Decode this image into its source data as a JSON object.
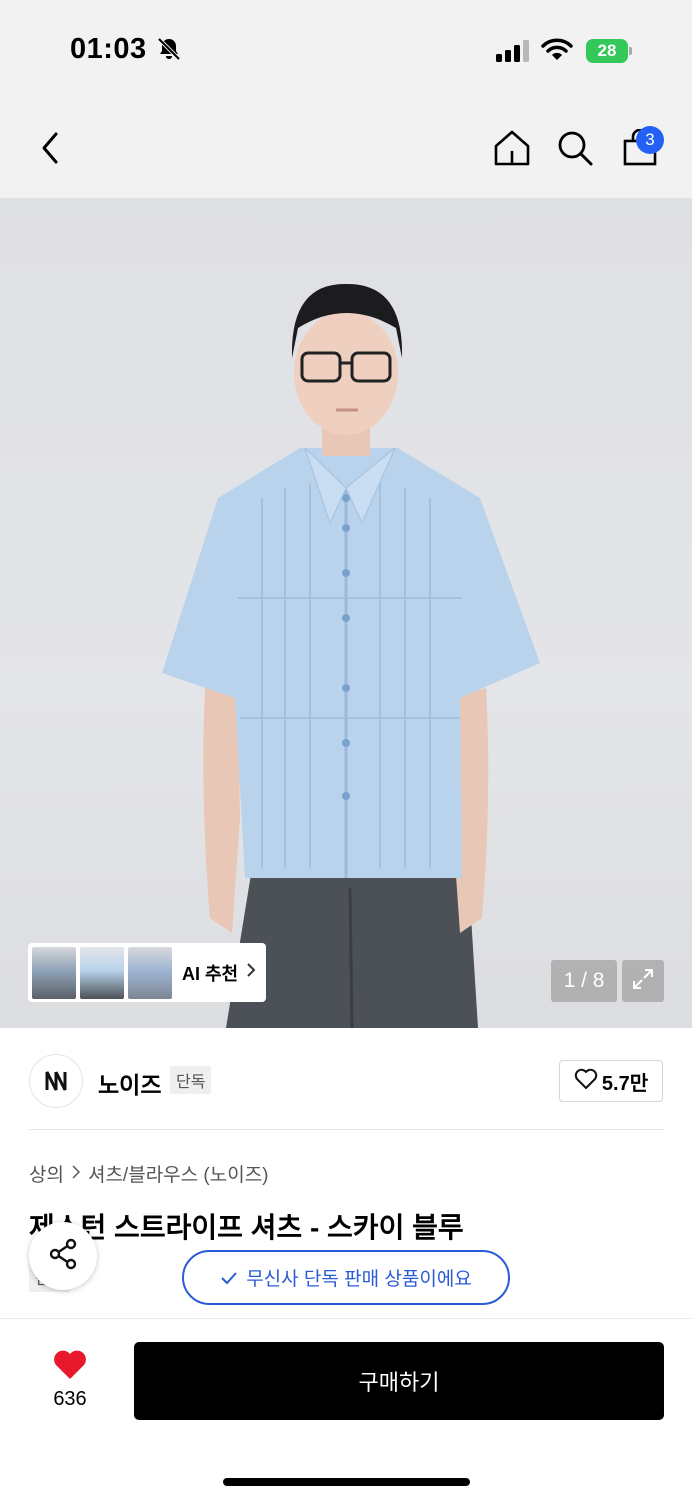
{
  "status_bar": {
    "time": "01:03",
    "battery": "28",
    "icons": [
      "bell-slash-icon",
      "signal-icon",
      "wifi-icon",
      "battery-charging-icon"
    ]
  },
  "nav": {
    "cart_count": "3",
    "icons": [
      "back-chevron-icon",
      "home-icon",
      "search-icon",
      "shopping-bag-icon"
    ]
  },
  "gallery": {
    "ai_label": "AI 추천",
    "page_indicator": "1 / 8"
  },
  "brand": {
    "name": "노이즈",
    "exclusive_tag": "단독",
    "likes": "5.7만"
  },
  "product": {
    "breadcrumb": [
      "상의",
      "셔츠/블라우스 (노이즈)"
    ],
    "title": "제스턴 스트라이프 셔츠 - 스카이 블루",
    "tag": "단독",
    "notice": "무신사 단독 판매 상품이에요"
  },
  "purchase": {
    "wish_count": "636",
    "buy_label": "구매하기"
  },
  "colors": {
    "accent_blue": "#2a5bd7",
    "badge_blue": "#2361f5",
    "heart_red": "#e8192c",
    "battery_green": "#34c759"
  }
}
